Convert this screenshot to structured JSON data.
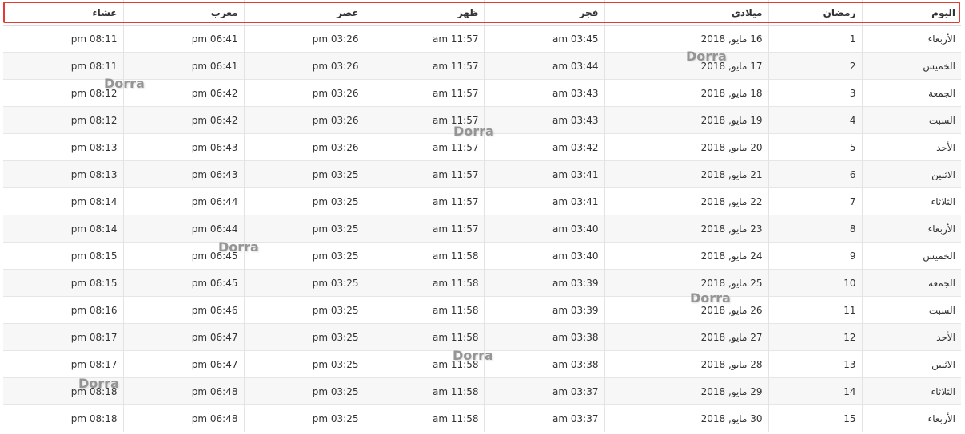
{
  "table": {
    "headers": [
      "اليوم",
      "رمضان",
      "ميلادي",
      "فجر",
      "ظهر",
      "عصر",
      "مغرب",
      "عشاء"
    ],
    "rows": [
      [
        "الأربعاء",
        "1",
        "16 مايو, 2018",
        "03:45 am",
        "11:57 am",
        "03:26 pm",
        "06:41 pm",
        "08:11 pm"
      ],
      [
        "الخميس",
        "2",
        "17 مايو, 2018",
        "03:44 am",
        "11:57 am",
        "03:26 pm",
        "06:41 pm",
        "08:11 pm"
      ],
      [
        "الجمعة",
        "3",
        "18 مايو, 2018",
        "03:43 am",
        "11:57 am",
        "03:26 pm",
        "06:42 pm",
        "08:12 pm"
      ],
      [
        "السبت",
        "4",
        "19 مايو, 2018",
        "03:43 am",
        "11:57 am",
        "03:26 pm",
        "06:42 pm",
        "08:12 pm"
      ],
      [
        "الأحد",
        "5",
        "20 مايو, 2018",
        "03:42 am",
        "11:57 am",
        "03:26 pm",
        "06:43 pm",
        "08:13 pm"
      ],
      [
        "الاثنين",
        "6",
        "21 مايو, 2018",
        "03:41 am",
        "11:57 am",
        "03:25 pm",
        "06:43 pm",
        "08:13 pm"
      ],
      [
        "الثلاثاء",
        "7",
        "22 مايو, 2018",
        "03:41 am",
        "11:57 am",
        "03:25 pm",
        "06:44 pm",
        "08:14 pm"
      ],
      [
        "الأربعاء",
        "8",
        "23 مايو, 2018",
        "03:40 am",
        "11:57 am",
        "03:25 pm",
        "06:44 pm",
        "08:14 pm"
      ],
      [
        "الخميس",
        "9",
        "24 مايو, 2018",
        "03:40 am",
        "11:58 am",
        "03:25 pm",
        "06:45 pm",
        "08:15 pm"
      ],
      [
        "الجمعة",
        "10",
        "25 مايو, 2018",
        "03:39 am",
        "11:58 am",
        "03:25 pm",
        "06:45 pm",
        "08:15 pm"
      ],
      [
        "السبت",
        "11",
        "26 مايو, 2018",
        "03:39 am",
        "11:58 am",
        "03:25 pm",
        "06:46 pm",
        "08:16 pm"
      ],
      [
        "الأحد",
        "12",
        "27 مايو, 2018",
        "03:38 am",
        "11:58 am",
        "03:25 pm",
        "06:47 pm",
        "08:17 pm"
      ],
      [
        "الاثنين",
        "13",
        "28 مايو, 2018",
        "03:38 am",
        "11:58 am",
        "03:25 pm",
        "06:47 pm",
        "08:17 pm"
      ],
      [
        "الثلاثاء",
        "14",
        "29 مايو, 2018",
        "03:37 am",
        "11:58 am",
        "03:25 pm",
        "06:48 pm",
        "08:18 pm"
      ],
      [
        "الأربعاء",
        "15",
        "30 مايو, 2018",
        "03:37 am",
        "11:58 am",
        "03:25 pm",
        "06:48 pm",
        "08:18 pm"
      ]
    ]
  },
  "watermark": {
    "text": "Dorra",
    "color": "#8a8a8a"
  },
  "highlight": {
    "color": "#e53935"
  }
}
